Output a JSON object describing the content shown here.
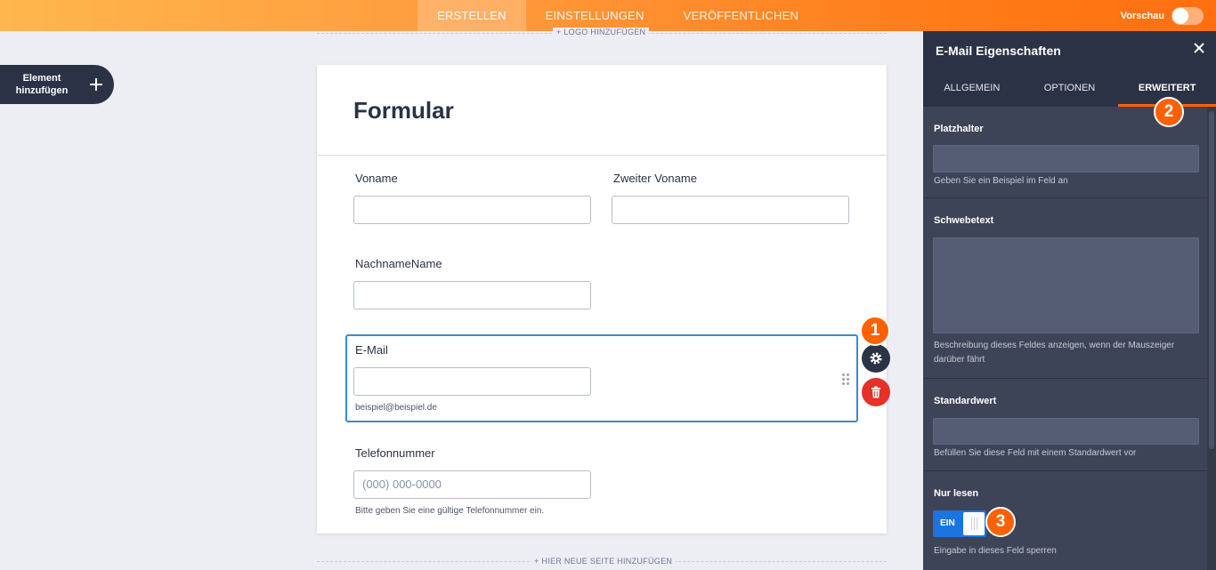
{
  "topbar": {
    "tabs": [
      {
        "label": "ERSTELLEN",
        "active": true
      },
      {
        "label": "EINSTELLUNGEN",
        "active": false
      },
      {
        "label": "VERÖFFENTLICHEN",
        "active": false
      }
    ],
    "preview_label": "Vorschau",
    "preview_on": false
  },
  "sidebar": {
    "add_element_line1": "Element",
    "add_element_line2": "hinzufügen",
    "add_icon": "plus-icon"
  },
  "canvas": {
    "add_logo": "+ LOGO HINZUFÜGEN",
    "add_page": "+ HIER NEUE SEITE HINZUFÜGEN"
  },
  "form": {
    "title": "Formular",
    "fields": {
      "first_name": {
        "label": "Voname",
        "value": ""
      },
      "middle_name": {
        "label": "Zweiter Voname",
        "value": ""
      },
      "last_name": {
        "label": "NachnameName",
        "value": ""
      },
      "email": {
        "label": "E-Mail",
        "value": "",
        "sublabel": "beispiel@beispiel.de"
      },
      "phone": {
        "label": "Telefonnummer",
        "placeholder": "(000) 000-0000",
        "sublabel": "Bitte geben Sie eine gültige Telefonnummer ein."
      }
    },
    "actions": {
      "settings_icon": "gear-icon",
      "delete_icon": "trash-icon",
      "drag_icon": "grip-icon"
    }
  },
  "badges": {
    "one": "1",
    "two": "2",
    "three": "3"
  },
  "panel": {
    "title": "E-Mail Eigenschaften",
    "close_icon": "close-icon",
    "tabs": [
      {
        "label": "ALLGEMEIN",
        "active": false
      },
      {
        "label": "OPTIONEN",
        "active": false
      },
      {
        "label": "ERWEITERT",
        "active": true
      }
    ],
    "sections": {
      "placeholder": {
        "title": "Platzhalter",
        "value": "",
        "hint": "Geben Sie ein Beispiel im Feld an"
      },
      "hover_text": {
        "title": "Schwebetext",
        "value": "",
        "hint": "Beschreibung dieses Feldes anzeigen, wenn der Mauszeiger darüber fährt"
      },
      "default_value": {
        "title": "Standardwert",
        "value": "",
        "hint": "Befüllen Sie diese Feld mit einem Standardwert vor"
      },
      "read_only": {
        "title": "Nur lesen",
        "toggle_label": "EIN",
        "on": true,
        "hint": "Eingabe in dieses Feld sperren"
      }
    }
  },
  "colors": {
    "accent_orange": "#ff6100",
    "dark": "#2b3245",
    "panel_bg": "#3e4457",
    "selected_blue": "#3a88d9",
    "delete_red": "#e4312a"
  }
}
